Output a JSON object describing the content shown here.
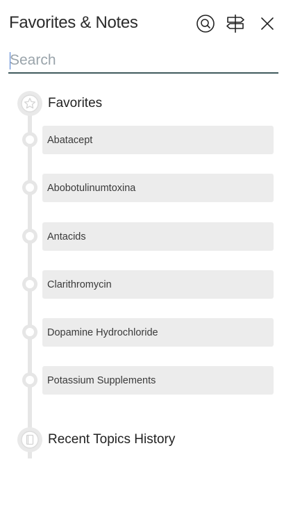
{
  "header": {
    "title": "Favorites & Notes",
    "icons": {
      "search": "search-icon",
      "signpost": "signpost-icon",
      "close": "close-icon"
    }
  },
  "search": {
    "placeholder": "Search",
    "value": ""
  },
  "favorites": {
    "label": "Favorites",
    "icon": "star-icon",
    "items": [
      {
        "label": "Abatacept"
      },
      {
        "label": "Abobotulinumtoxina"
      },
      {
        "label": "Antacids"
      },
      {
        "label": "Clarithromycin"
      },
      {
        "label": "Dopamine Hydrochloride"
      },
      {
        "label": "Potassium Supplements"
      }
    ]
  },
  "history": {
    "label": "Recent Topics History",
    "icon": "book-icon"
  },
  "colors": {
    "search_underline": "#3f5a5c",
    "card_bg": "#ececec",
    "timeline": "#e6e6e6"
  }
}
